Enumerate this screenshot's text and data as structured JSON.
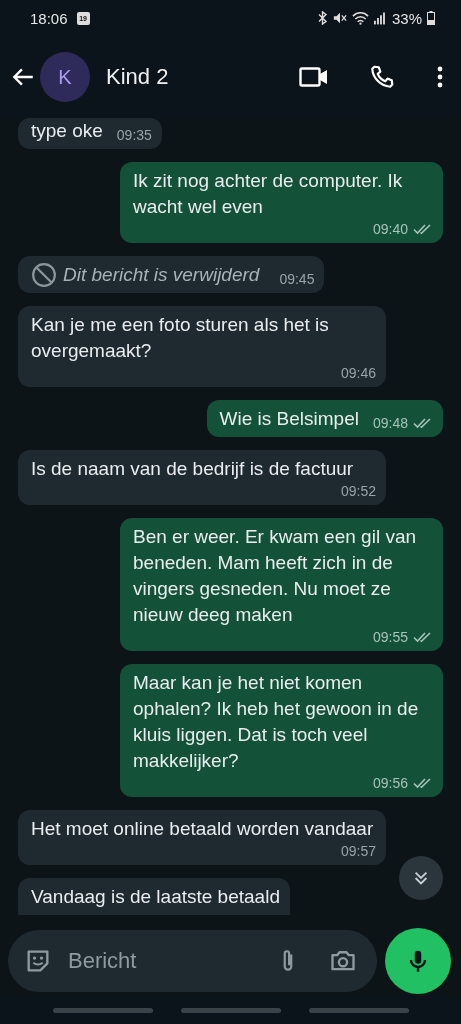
{
  "status_bar": {
    "time": "18:06",
    "calendar_day": "19",
    "battery": "33%"
  },
  "header": {
    "avatar_letter": "K",
    "title": "Kind 2"
  },
  "messages": [
    {
      "kind": "in",
      "text": "type oke",
      "time": "09:35"
    },
    {
      "kind": "out",
      "text": "Ik zit nog achter de computer. Ik wacht wel even",
      "time": "09:40",
      "read": false
    },
    {
      "kind": "deleted",
      "text": "Dit bericht is verwijderd",
      "time": "09:45"
    },
    {
      "kind": "in",
      "text": "Kan je me een foto sturen als het is overgemaakt?",
      "time": "09:46"
    },
    {
      "kind": "out",
      "text": "Wie is Belsimpel",
      "time": "09:48",
      "read": false
    },
    {
      "kind": "in",
      "text": "Is de naam van de bedrijf is de factuur",
      "time": "09:52"
    },
    {
      "kind": "out",
      "text": "Ben er weer. Er kwam een gil van beneden.  Mam heeft zich in de vingers gesneden.  Nu moet ze nieuw deeg maken",
      "time": "09:55",
      "read": false
    },
    {
      "kind": "out",
      "text": "Maar kan je het niet komen ophalen? Ik heb het gewoon in de kluis liggen. Dat is toch veel makkelijker?",
      "time": "09:56",
      "read": false
    },
    {
      "kind": "in",
      "text": "Het moet online betaald worden vandaar",
      "time": "09:57"
    },
    {
      "kind": "in",
      "text": "Vandaag is de laatste betaald"
    }
  ],
  "composer": {
    "placeholder": "Bericht"
  }
}
